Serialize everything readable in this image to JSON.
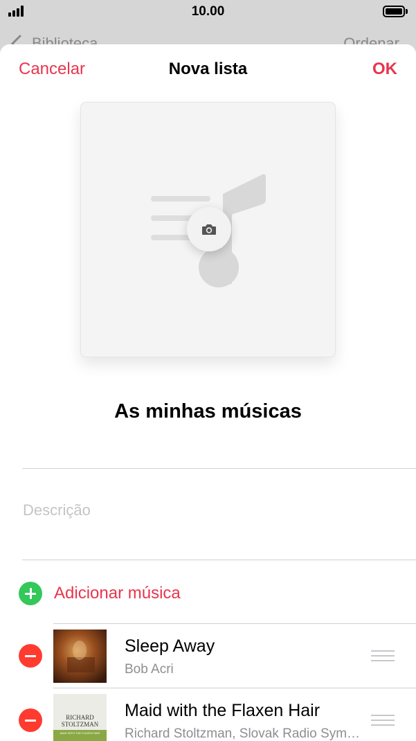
{
  "status_bar": {
    "time": "10.00"
  },
  "background_nav": {
    "back_label": "Biblioteca",
    "sort_label": "Ordenar"
  },
  "nav": {
    "cancel": "Cancelar",
    "title": "Nova lista",
    "ok": "OK"
  },
  "playlist": {
    "name": "As minhas músicas",
    "description_placeholder": "Descrição"
  },
  "add_music": {
    "label": "Adicionar música"
  },
  "songs": [
    {
      "title": "Sleep Away",
      "artist": "Bob Acri"
    },
    {
      "title": "Maid with the Flaxen Hair",
      "artist": "Richard Stoltzman, Slovak Radio Symphony Orchestra"
    }
  ],
  "album_art_text": {
    "stoltzman_line1": "RICHARD",
    "stoltzman_line2": "STOLTZMAN",
    "stoltzman_line3": "MAID WITH THE FLAXEN HAIR"
  },
  "colors": {
    "accent": "#e8354e",
    "add": "#34c759",
    "remove": "#ff3b30"
  }
}
